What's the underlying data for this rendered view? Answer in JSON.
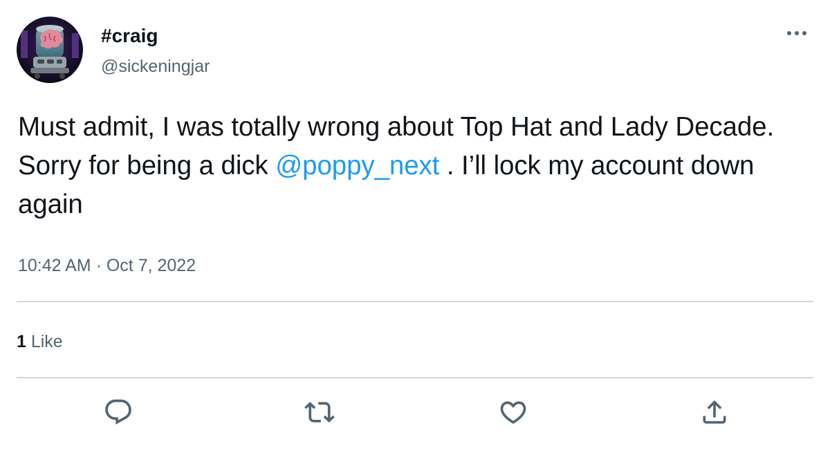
{
  "user": {
    "display_name": "#craig",
    "handle": "@sickeningjar",
    "avatar_icon": "brain-in-jar-avatar"
  },
  "tweet": {
    "text_before": "Must admit, I was totally wrong about Top Hat and Lady Decade. Sorry for being a dick ",
    "mention": "@poppy_next",
    "text_after": " . I’ll lock my account down again",
    "time": "10:42 AM",
    "separator": " · ",
    "date": "Oct 7, 2022"
  },
  "stats": {
    "like_count": "1",
    "like_label": " Like"
  },
  "actions": [
    {
      "name": "reply",
      "icon": "reply-icon"
    },
    {
      "name": "retweet",
      "icon": "retweet-icon"
    },
    {
      "name": "like",
      "icon": "heart-icon"
    },
    {
      "name": "share",
      "icon": "share-icon"
    }
  ],
  "colors": {
    "link": "#1d9bf0",
    "secondary_text": "#536471",
    "primary_text": "#0f1419",
    "divider": "#cfd9de"
  }
}
